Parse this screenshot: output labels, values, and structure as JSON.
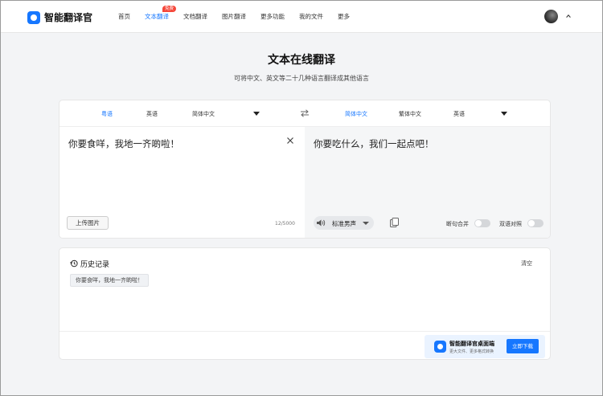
{
  "header": {
    "brand": "智能翻译官",
    "nav": [
      {
        "label": "首页"
      },
      {
        "label": "文本翻译",
        "badge": "免费"
      },
      {
        "label": "文档翻译"
      },
      {
        "label": "图片翻译"
      },
      {
        "label": "更多功能"
      },
      {
        "label": "我的文件"
      },
      {
        "label": "更多"
      }
    ],
    "active_nav": "文本翻译",
    "accent": "#1677ff",
    "badge_color": "#f5473a"
  },
  "hero": {
    "title": "文本在线翻译",
    "subtitle": "可将中文、英文等二十几种语言翻译成其他语言"
  },
  "translator": {
    "source_langs": [
      "粤语",
      "英语",
      "简体中文"
    ],
    "source_active": "粤语",
    "target_langs": [
      "简体中文",
      "繁体中文",
      "英语"
    ],
    "target_active": "简体中文",
    "source_text": "你要食咩，我地一齐啲啦！",
    "target_text": "你要吃什么，我们一起点吧！",
    "upload_label": "上传图片",
    "char_count": "12/5000",
    "voice": "标准男声",
    "option_merge": "断句合并",
    "option_bilingual": "双语对照",
    "merge_on": false,
    "bilingual_on": false
  },
  "history": {
    "title": "历史记录",
    "clear_label": "清空",
    "items": [
      "你要食咩，我地一齐啲啦！"
    ]
  },
  "promo": {
    "title": "智能翻译官桌面端",
    "subtitle": "更大文件、更多格式转换",
    "button": "立即下载"
  }
}
